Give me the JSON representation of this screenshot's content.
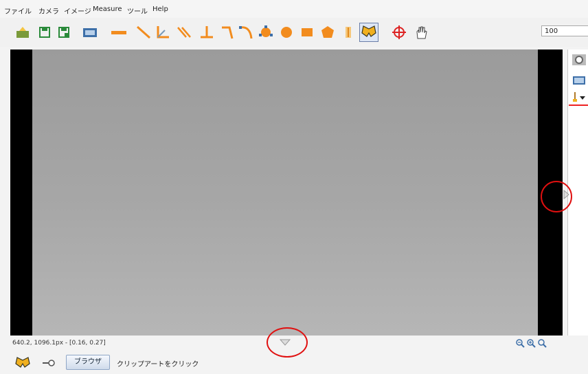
{
  "menu": {
    "items": [
      "ファイル",
      "カメラ",
      "イメージ",
      "Measure",
      "ツール",
      "Help"
    ]
  },
  "toolbar": {
    "zoom_value": "100",
    "icons": [
      "open-icon",
      "save-icon",
      "save-as-icon",
      "capture-image-icon",
      "ruler-icon",
      "line-icon",
      "angle-icon",
      "parallel-lines-icon",
      "perpendicular-icon",
      "polyline-icon",
      "curve-icon",
      "circle-3point-icon",
      "circle-icon",
      "rectangle-icon",
      "polygon-icon",
      "text-icon",
      "butterfly-icon",
      "crosshair-icon",
      "hand-icon"
    ]
  },
  "status": {
    "coordinates": "640.2, 1096.1px - [0.16, 0.27]"
  },
  "bottom": {
    "browse_label": "ブラウザ",
    "clipart_label": "クリップアートをクリック"
  },
  "colors": {
    "accent_red": "#e01010",
    "image_gray": "#a7a7a7",
    "icon_orange": "#f28c1e",
    "icon_green": "#2a8a3a"
  }
}
